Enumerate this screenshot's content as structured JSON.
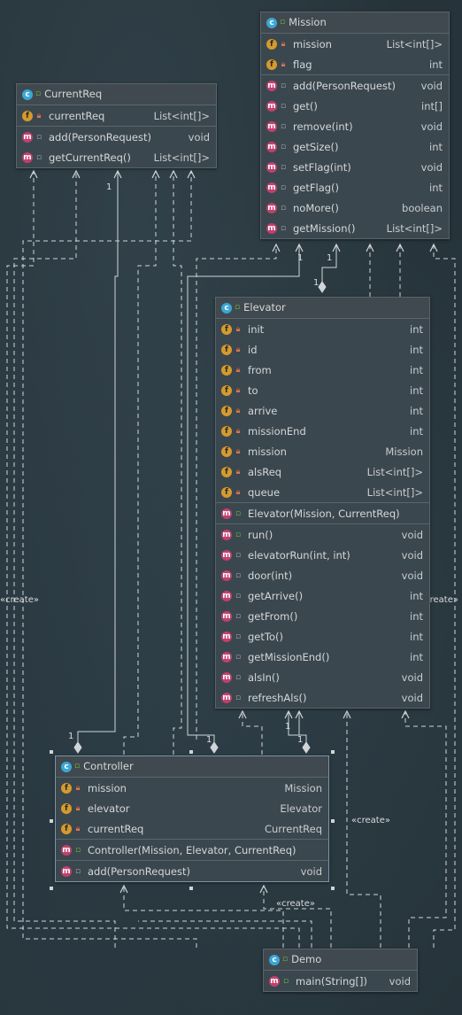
{
  "classes": {
    "mission": {
      "name": "Mission",
      "fields": [
        {
          "name": "mission",
          "type": "List<int[]>"
        },
        {
          "name": "flag",
          "type": "int"
        }
      ],
      "methods": [
        {
          "name": "add(PersonRequest)",
          "type": "void"
        },
        {
          "name": "get()",
          "type": "int[]"
        },
        {
          "name": "remove(int)",
          "type": "void"
        },
        {
          "name": "getSize()",
          "type": "int"
        },
        {
          "name": "setFlag(int)",
          "type": "void"
        },
        {
          "name": "getFlag()",
          "type": "int"
        },
        {
          "name": "noMore()",
          "type": "boolean"
        },
        {
          "name": "getMission()",
          "type": "List<int[]>"
        }
      ]
    },
    "currentreq": {
      "name": "CurrentReq",
      "fields": [
        {
          "name": "currentReq",
          "type": "List<int[]>"
        }
      ],
      "methods": [
        {
          "name": "add(PersonRequest)",
          "type": "void"
        },
        {
          "name": "getCurrentReq()",
          "type": "List<int[]>"
        }
      ]
    },
    "elevator": {
      "name": "Elevator",
      "fields": [
        {
          "name": "init",
          "type": "int"
        },
        {
          "name": "id",
          "type": "int"
        },
        {
          "name": "from",
          "type": "int"
        },
        {
          "name": "to",
          "type": "int"
        },
        {
          "name": "arrive",
          "type": "int"
        },
        {
          "name": "missionEnd",
          "type": "int"
        },
        {
          "name": "mission",
          "type": "Mission"
        },
        {
          "name": "alsReq",
          "type": "List<int[]>"
        },
        {
          "name": "queue",
          "type": "List<int[]>"
        }
      ],
      "constructors": [
        {
          "name": "Elevator(Mission, CurrentReq)",
          "type": ""
        }
      ],
      "methods": [
        {
          "name": "run()",
          "type": "void"
        },
        {
          "name": "elevatorRun(int, int)",
          "type": "void"
        },
        {
          "name": "door(int)",
          "type": "void"
        },
        {
          "name": "getArrive()",
          "type": "int"
        },
        {
          "name": "getFrom()",
          "type": "int"
        },
        {
          "name": "getTo()",
          "type": "int"
        },
        {
          "name": "getMissionEnd()",
          "type": "int"
        },
        {
          "name": "alsIn()",
          "type": "void"
        },
        {
          "name": "refreshAls()",
          "type": "void"
        }
      ]
    },
    "controller": {
      "name": "Controller",
      "fields": [
        {
          "name": "mission",
          "type": "Mission"
        },
        {
          "name": "elevator",
          "type": "Elevator"
        },
        {
          "name": "currentReq",
          "type": "CurrentReq"
        }
      ],
      "constructors": [
        {
          "name": "Controller(Mission, Elevator, CurrentReq)",
          "type": ""
        }
      ],
      "methods": [
        {
          "name": "add(PersonRequest)",
          "type": "void"
        }
      ]
    },
    "demo": {
      "name": "Demo",
      "fields": [],
      "methods": [
        {
          "name": "main(String[])",
          "type": "void"
        }
      ]
    }
  },
  "labels": {
    "create_left": "«create»",
    "create_right": "«create»",
    "create_mid": "«create»",
    "create_bottom": "«create»",
    "one": "1"
  },
  "colors": {
    "background": "#26333a",
    "box": "#3b474e",
    "edge": "#d0d5d8",
    "class_icon": "#3aa7d6",
    "field_icon": "#d59a2d",
    "method_icon": "#c0406e"
  }
}
